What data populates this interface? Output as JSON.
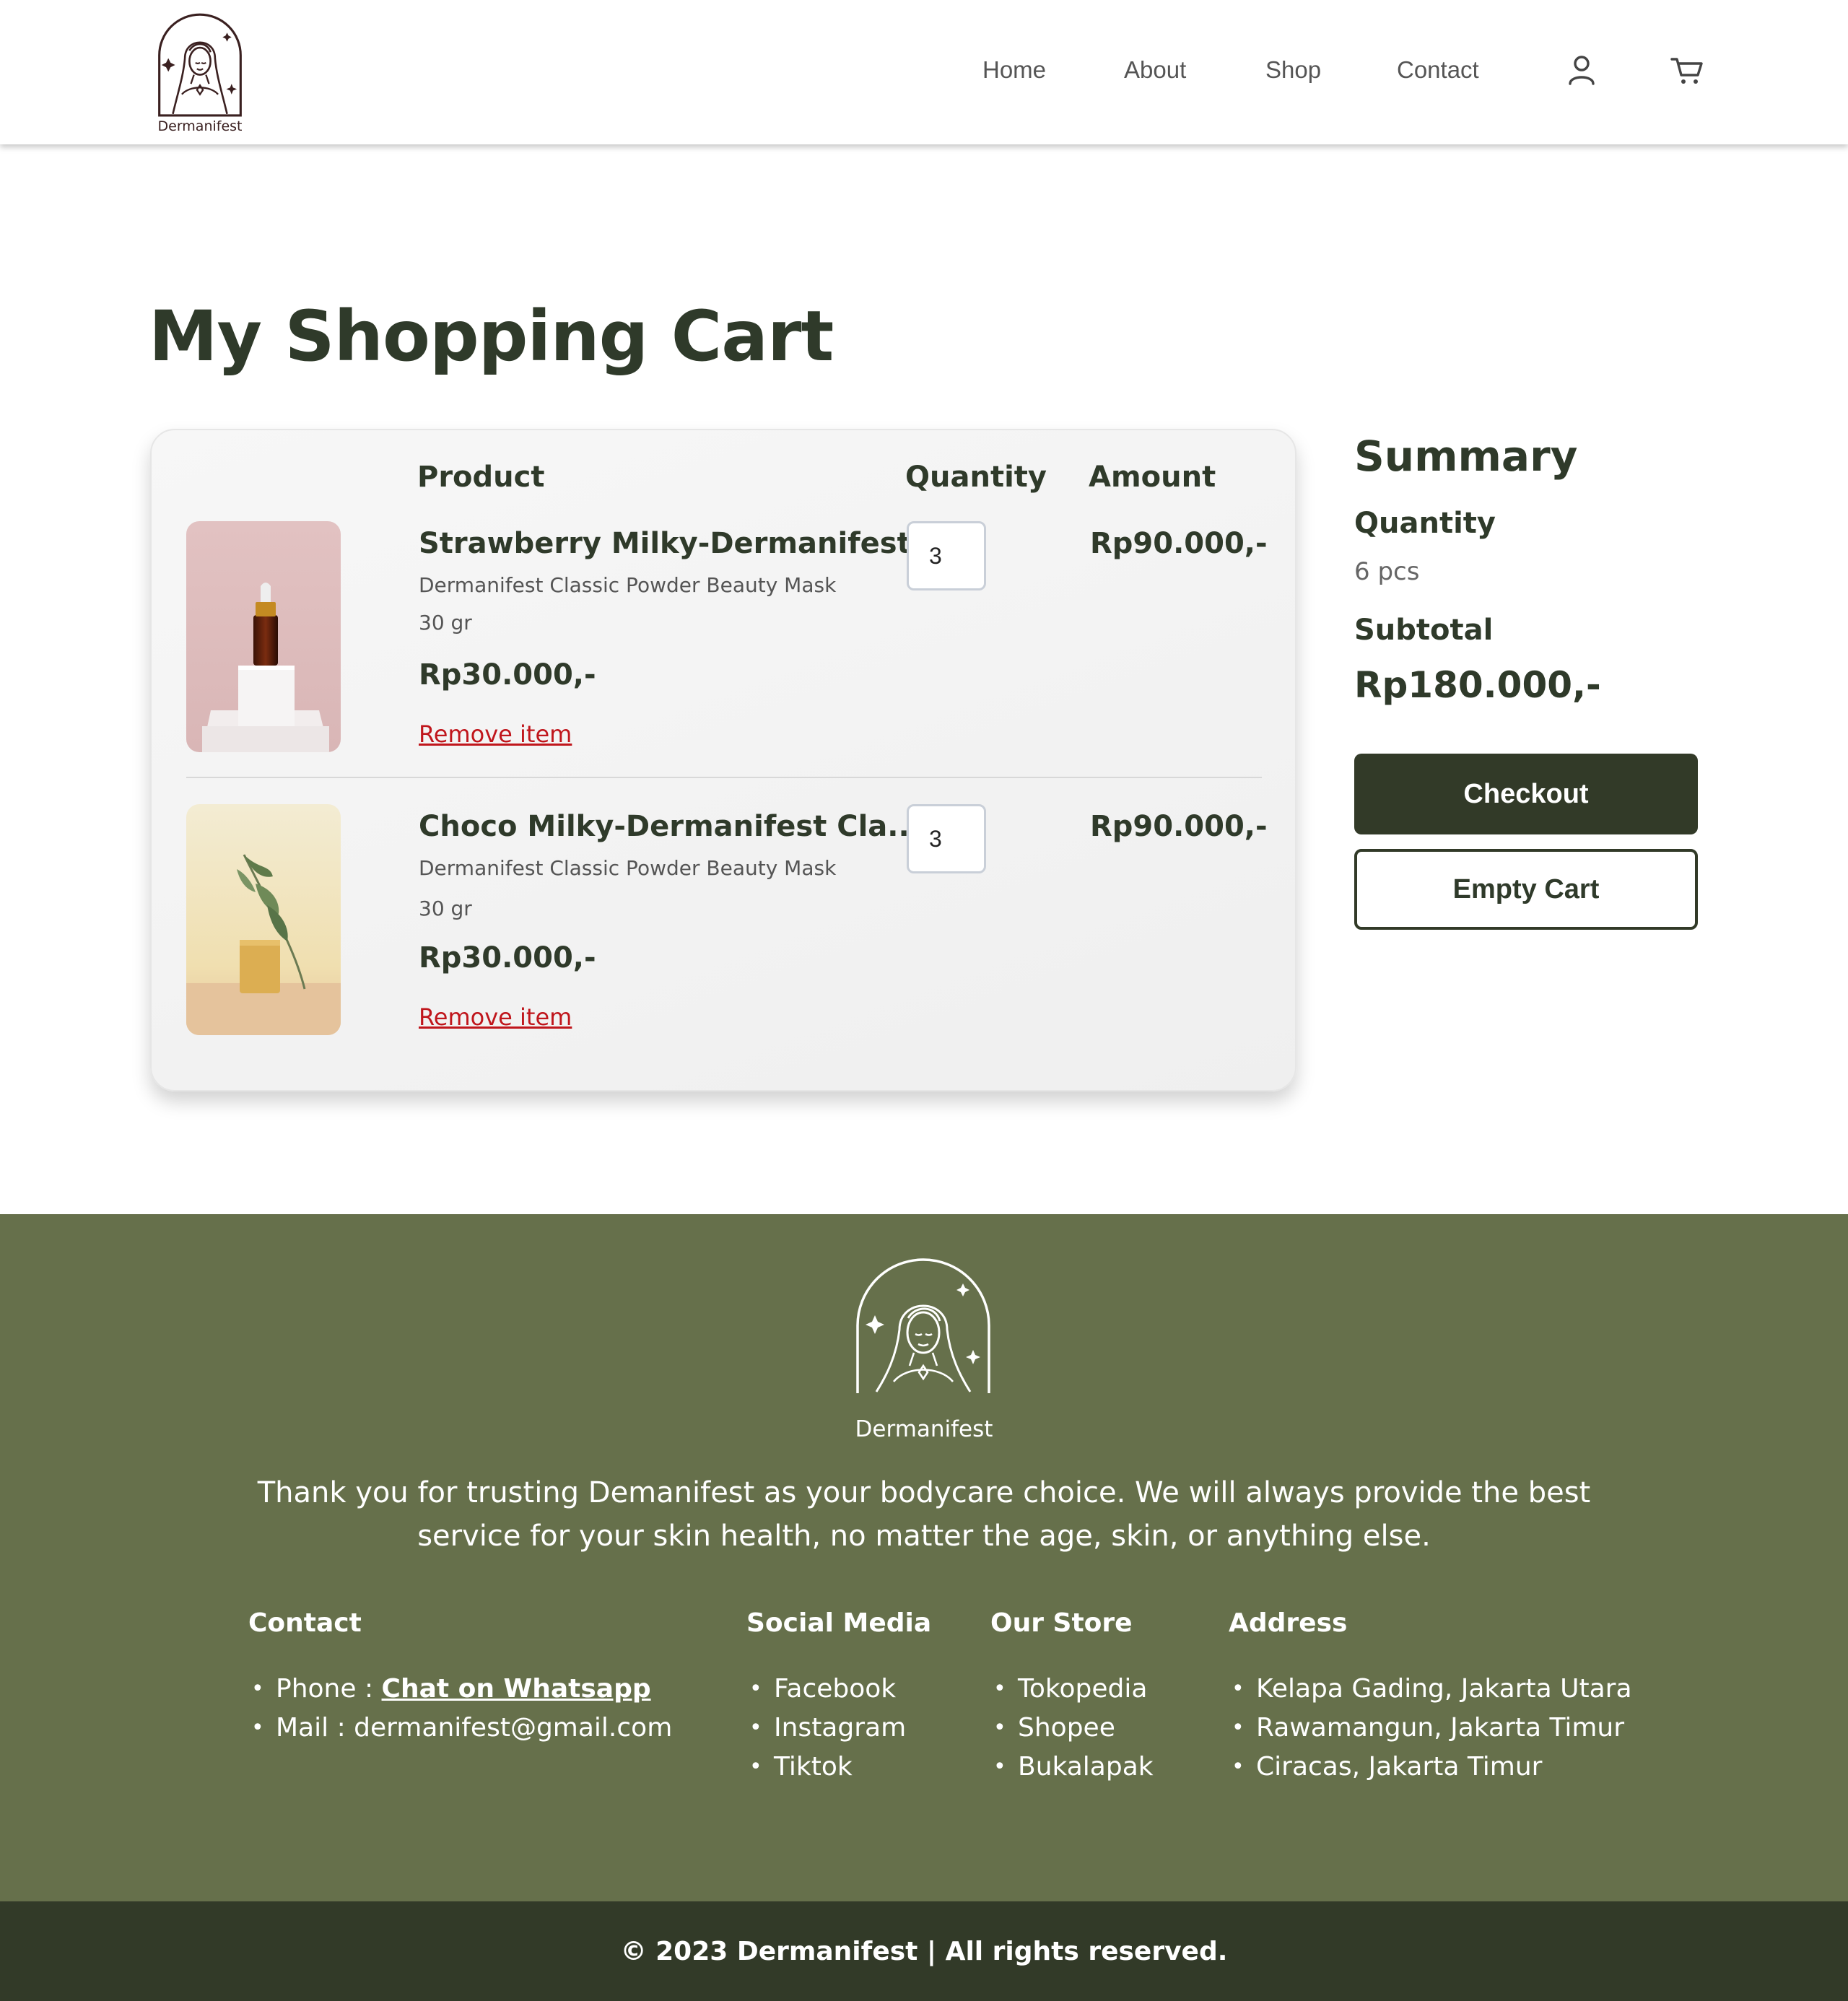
{
  "brand": {
    "name": "Dermanifest"
  },
  "nav": {
    "links": [
      "Home",
      "About",
      "Shop",
      "Contact"
    ],
    "icons": [
      "user-icon",
      "cart-icon"
    ]
  },
  "page": {
    "title": "My Shopping Cart"
  },
  "cart": {
    "headers": {
      "product": "Product",
      "quantity": "Quantity",
      "amount": "Amount"
    },
    "items": [
      {
        "name": "Strawberry Milky-Dermanifest...",
        "description": "Dermanifest Classic Powder Beauty Mask",
        "weight": "30 gr",
        "price": "Rp30.000,-",
        "quantity": "3",
        "amount": "Rp90.000,-",
        "remove_label": "Remove item",
        "image": "serum-dropper-bottle-on-pink-background"
      },
      {
        "name": "Choco Milky-Dermanifest Cla...",
        "description": "Dermanifest Classic Powder Beauty Mask",
        "weight": "30 gr",
        "price": "Rp30.000,-",
        "quantity": "3",
        "amount": "Rp90.000,-",
        "remove_label": "Remove item",
        "image": "soap-bar-with-eucalyptus-leaf"
      }
    ]
  },
  "summary": {
    "title": "Summary",
    "quantity_label": "Quantity",
    "quantity_value": "6 pcs",
    "subtotal_label": "Subtotal",
    "subtotal_value": "Rp180.000,-",
    "checkout_label": "Checkout",
    "empty_label": "Empty Cart"
  },
  "footer": {
    "logo_text": "Dermanifest",
    "tagline": "Thank you for trusting Demanifest as your bodycare choice. We will always provide the best service for your skin health, no matter the age, skin, or anything else.",
    "contact": {
      "title": "Contact",
      "phone_prefix": "Phone : ",
      "phone_link": "Chat on Whatsapp",
      "mail": "Mail : dermanifest@gmail.com"
    },
    "social": {
      "title": "Social Media",
      "items": [
        "Facebook",
        "Instagram",
        "Tiktok"
      ]
    },
    "store": {
      "title": "Our Store",
      "items": [
        "Tokopedia",
        "Shopee",
        "Bukalapak"
      ]
    },
    "address": {
      "title": "Address",
      "items": [
        "Kelapa Gading, Jakarta Utara",
        "Rawamangun, Jakarta Timur",
        "Ciracas, Jakarta Timur"
      ]
    },
    "copyright": "© 2023 Dermanifest | All rights reserved."
  },
  "colors": {
    "primary_dark": "#323a28",
    "footer_green": "#66704b",
    "remove_red": "#c0161c",
    "text_dark": "#2f3a2a"
  }
}
